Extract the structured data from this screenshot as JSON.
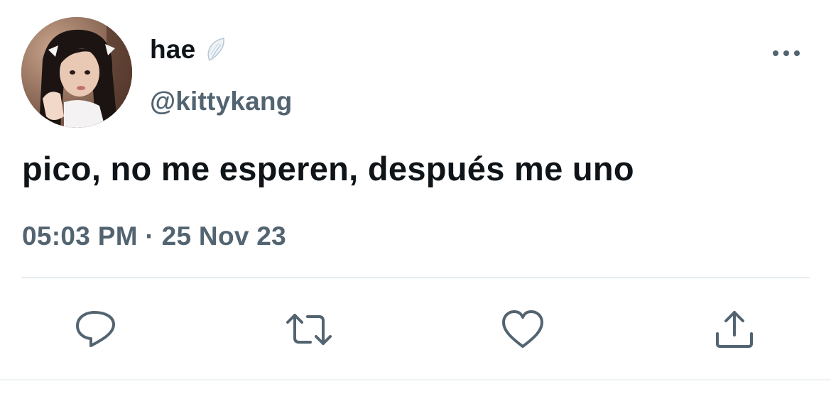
{
  "tweet": {
    "display_name": "hae",
    "handle": "@kittykang",
    "text": "pico, no me esperen, después me uno",
    "timestamp": "05:03 PM · 25 Nov 23"
  },
  "icons": {
    "badge": "angel-wing-icon",
    "more": "more-horizontal-icon",
    "reply": "reply-icon",
    "retweet": "retweet-icon",
    "like": "heart-icon",
    "share": "share-icon"
  },
  "colors": {
    "text_primary": "#0f1419",
    "text_secondary": "#536471",
    "icon": "#536471",
    "divider": "#e6ecf0"
  }
}
